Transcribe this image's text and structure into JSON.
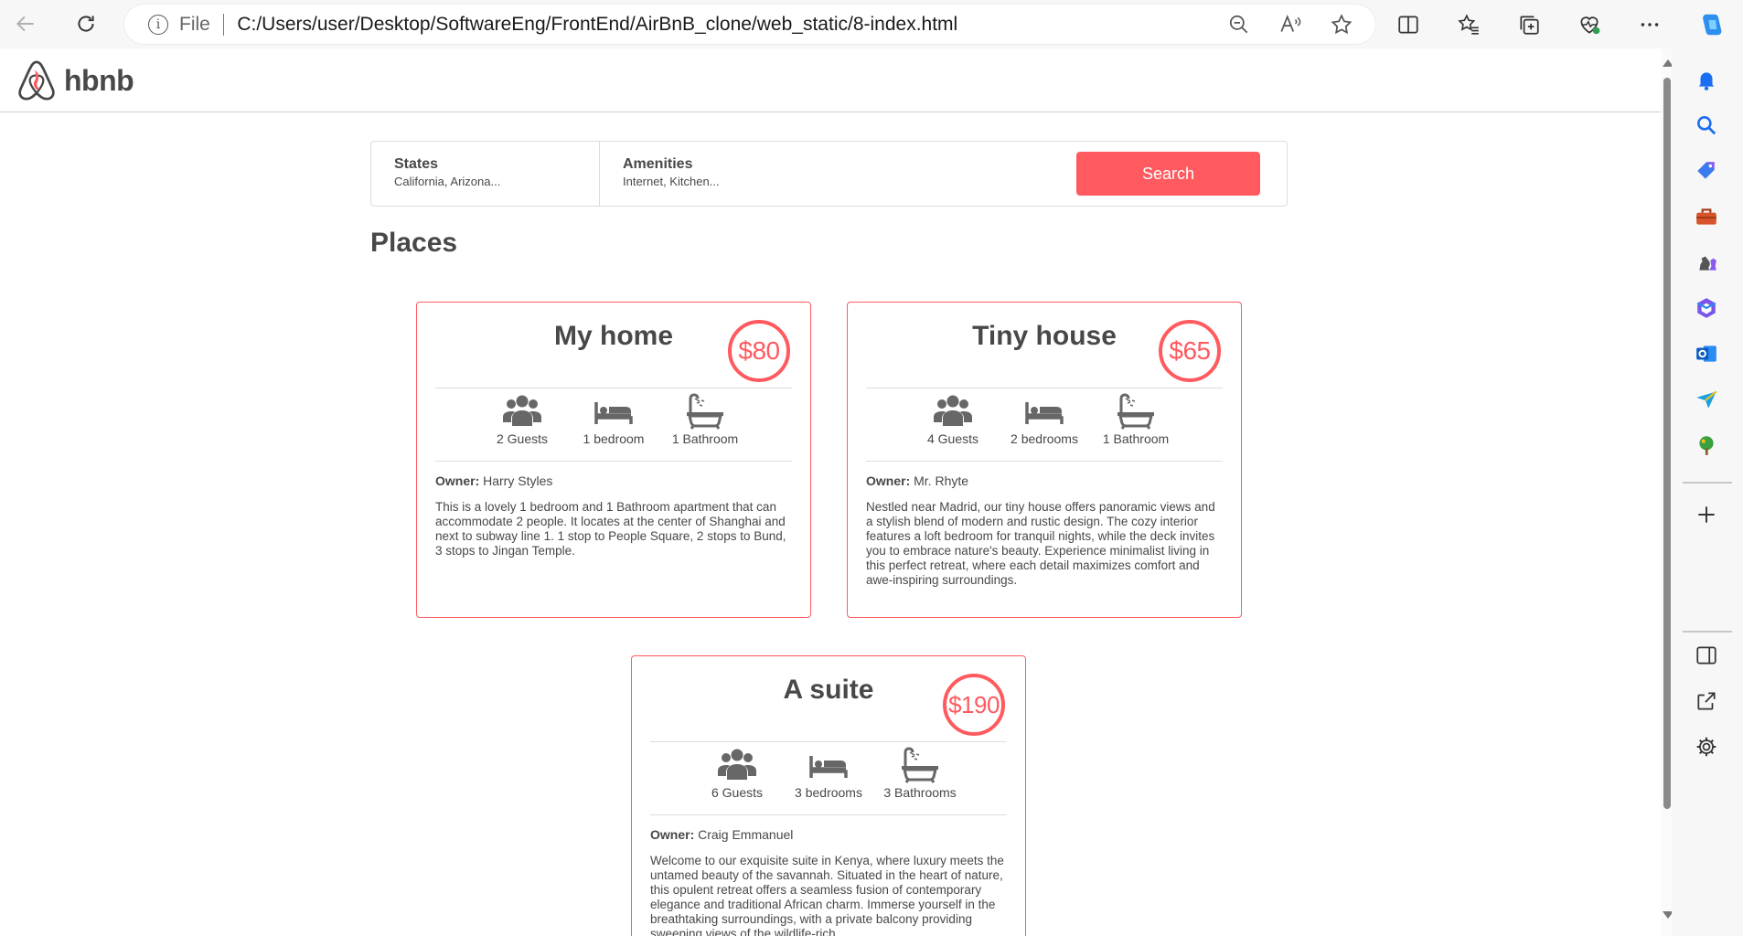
{
  "browser": {
    "file_label": "File",
    "url": "C:/Users/user/Desktop/SoftwareEng/FrontEnd/AirBnB_clone/web_static/8-index.html"
  },
  "header": {
    "logo_text": "hbnb",
    "brand_color": "#ff5a5f"
  },
  "filters": {
    "states_title": "States",
    "states_value": "California, Arizona...",
    "amenities_title": "Amenities",
    "amenities_value": "Internet, Kitchen...",
    "search_label": "Search"
  },
  "places_title": "Places",
  "places": [
    {
      "name": "My home",
      "price": "$80",
      "guests": "2 Guests",
      "rooms": "1 bedroom",
      "bathrooms": "1 Bathroom",
      "owner_label": "Owner:",
      "owner": "Harry Styles",
      "description": "This is a lovely 1 bedroom and 1 Bathroom apartment that can accommodate 2 people. It locates at the center of Shanghai and next to subway line 1. 1 stop to People Square, 2 stops to Bund, 3 stops to Jingan Temple."
    },
    {
      "name": "Tiny house",
      "price": "$65",
      "guests": "4 Guests",
      "rooms": "2 bedrooms",
      "bathrooms": "1 Bathroom",
      "owner_label": "Owner:",
      "owner": "Mr. Rhyte",
      "description": "Nestled near Madrid, our tiny house offers panoramic views and a stylish blend of modern and rustic design. The cozy interior features a loft bedroom for tranquil nights, while the deck invites you to embrace nature's beauty. Experience minimalist living in this perfect retreat, where each detail maximizes comfort and awe-inspiring surroundings."
    },
    {
      "name": "A suite",
      "price": "$190",
      "guests": "6 Guests",
      "rooms": "3 bedrooms",
      "bathrooms": "3 Bathrooms",
      "owner_label": "Owner:",
      "owner": "Craig Emmanuel",
      "description": "Welcome to our exquisite suite in Kenya, where luxury meets the untamed beauty of the savannah. Situated in the heart of nature, this opulent retreat offers a seamless fusion of contemporary elegance and traditional African charm. Immerse yourself in the breathtaking surroundings, with a private balcony providing sweeping views of the wildlife-rich"
    }
  ],
  "icons": {
    "guests": "users-icon",
    "rooms": "bed-icon",
    "bathrooms": "bath-icon"
  }
}
